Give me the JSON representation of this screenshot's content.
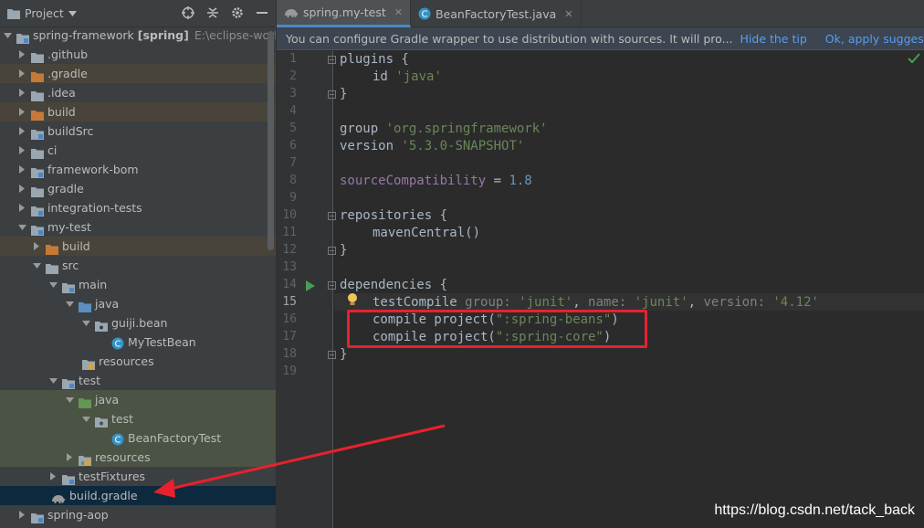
{
  "project_panel": {
    "title": "Project",
    "tree": [
      {
        "label": "spring-framework",
        "bold": "[spring]",
        "path": "E:\\eclipse-worksp"
      },
      {
        "label": ".github"
      },
      {
        "label": ".gradle"
      },
      {
        "label": ".idea"
      },
      {
        "label": "build"
      },
      {
        "label": "buildSrc"
      },
      {
        "label": "ci"
      },
      {
        "label": "framework-bom"
      },
      {
        "label": "gradle"
      },
      {
        "label": "integration-tests"
      },
      {
        "label": "my-test"
      },
      {
        "label": "build"
      },
      {
        "label": "src"
      },
      {
        "label": "main"
      },
      {
        "label": "java"
      },
      {
        "label": "guiji.bean"
      },
      {
        "label": "MyTestBean"
      },
      {
        "label": "resources"
      },
      {
        "label": "test"
      },
      {
        "label": "java"
      },
      {
        "label": "test"
      },
      {
        "label": "BeanFactoryTest"
      },
      {
        "label": "resources"
      },
      {
        "label": "testFixtures"
      },
      {
        "label": "build.gradle"
      },
      {
        "label": "spring-aop"
      }
    ]
  },
  "editor": {
    "tabs": [
      {
        "label": "spring.my-test"
      },
      {
        "label": "BeanFactoryTest.java"
      }
    ],
    "banner": {
      "message": "You can configure Gradle wrapper to use distribution with sources. It will pro...",
      "hide_tip": "Hide the tip",
      "apply": "Ok, apply suggestion!"
    },
    "code": {
      "l1": "plugins {",
      "l2_id": "id ",
      "l2_str": "'java'",
      "l3": "}",
      "l5_kw": "group ",
      "l5_str": "'org.springframework'",
      "l6_kw": "version ",
      "l6_str": "'5.3.0-SNAPSHOT'",
      "l8_prop": "sourceCompatibility",
      "l8_eq": " = ",
      "l8_num": "1.8",
      "l10": "repositories {",
      "l11": "mavenCentral()",
      "l12": "}",
      "l14": "dependencies {",
      "l15_fn": "testCompile ",
      "l15_k1": "group: ",
      "l15_v1": "'junit'",
      "l15_c1": ", ",
      "l15_k2": "name: ",
      "l15_v2": "'junit'",
      "l15_c2": ", ",
      "l15_k3": "version: ",
      "l15_v3": "'4.12'",
      "l16_a": "compile project(",
      "l16_s": "\":spring-beans\"",
      "l16_b": ")",
      "l17_a": "compile project(",
      "l17_s": "\":spring-core\"",
      "l17_b": ")",
      "l18": "}"
    },
    "line_numbers": [
      "1",
      "2",
      "3",
      "4",
      "5",
      "6",
      "7",
      "8",
      "9",
      "10",
      "11",
      "12",
      "13",
      "14",
      "15",
      "16",
      "17",
      "18",
      "19"
    ]
  },
  "watermark": "https://blog.csdn.net/tack_back",
  "colors": {
    "accent": "#4a88c7",
    "annotation_red": "#e8212d",
    "folder_blue": "#5c8fbf",
    "folder_orange": "#c7793a",
    "folder_green": "#629755"
  }
}
